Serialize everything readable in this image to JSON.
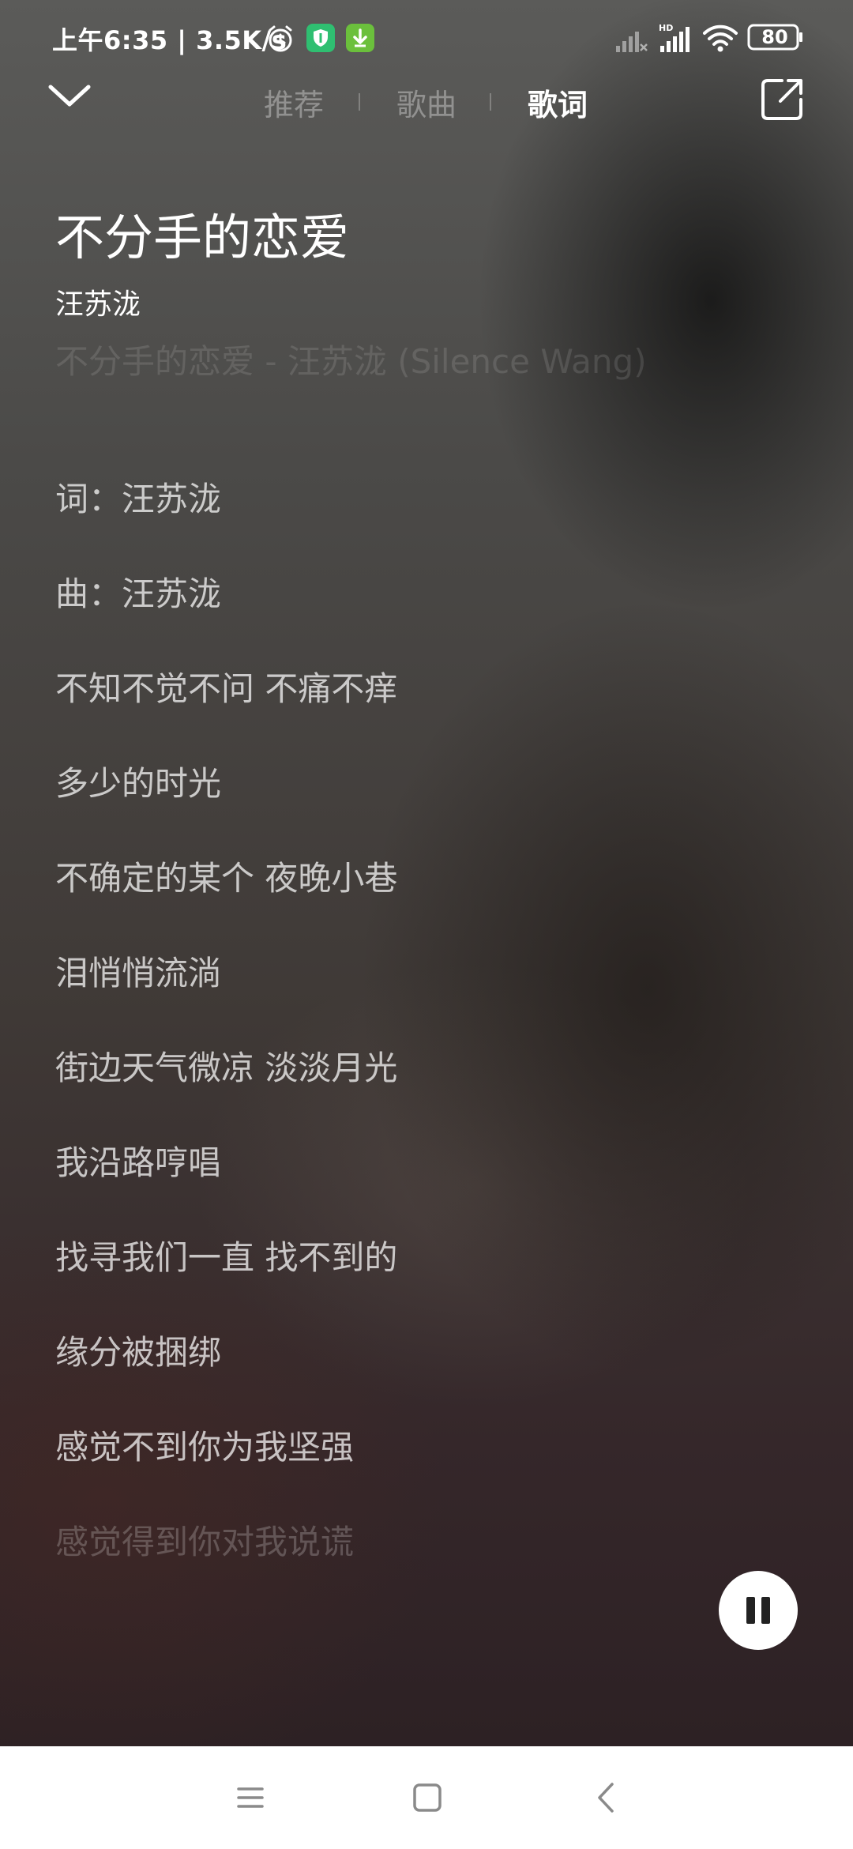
{
  "status_bar": {
    "time": "上午6:35 | 3.5K/s",
    "battery": "80",
    "icons": [
      "alarm-icon",
      "shield-icon",
      "download-icon",
      "signal-icon",
      "hd-signal-icon",
      "wifi-icon",
      "battery-icon"
    ],
    "hd_label": "HD"
  },
  "nav": {
    "tabs": [
      {
        "label": "推荐",
        "active": false
      },
      {
        "label": "歌曲",
        "active": false
      },
      {
        "label": "歌词",
        "active": true
      }
    ],
    "left_icon": "chevron-down-icon",
    "right_icon": "share-icon"
  },
  "song": {
    "title": "不分手的恋爱",
    "artist": "汪苏泷",
    "header": "不分手的恋爱 - 汪苏泷 (Silence Wang)"
  },
  "lyrics": [
    "词：汪苏泷",
    "曲：汪苏泷",
    "不知不觉不问 不痛不痒",
    "多少的时光",
    "不确定的某个 夜晚小巷",
    "泪悄悄流淌",
    "街边天气微凉 淡淡月光",
    "我沿路哼唱",
    "找寻我们一直 找不到的",
    "缘分被捆绑",
    "感觉不到你为我坚强",
    "感觉得到你对我说谎"
  ],
  "player": {
    "state_icon": "pause-icon"
  },
  "system_nav": {
    "icons": [
      "menu-icon",
      "home-icon",
      "back-icon"
    ]
  },
  "colors": {
    "accent_white": "#ffffff",
    "nav_bar_bg": "#ffffff",
    "shield_green": "#2fbf71",
    "download_green": "#6bc03c"
  }
}
